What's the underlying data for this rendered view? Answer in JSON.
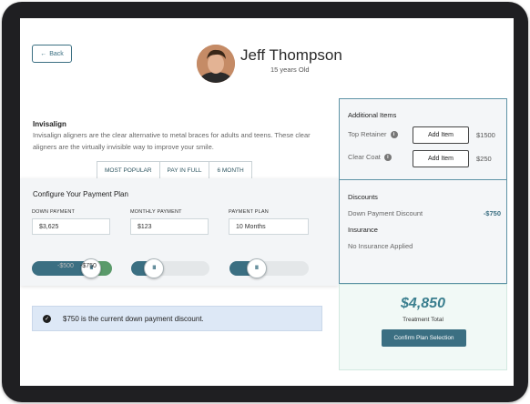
{
  "header": {
    "back_label": "Back",
    "back_icon": "arrow-left-icon",
    "patient_name": "Jeff Thompson",
    "patient_age": "15 years Old"
  },
  "product": {
    "title": "Invisalign",
    "description": "Invisalign aligners are the clear alternative to metal braces for adults and teens. These clear aligners are the virtually invisible way to improve your smile."
  },
  "tabs": [
    {
      "label": "MOST POPULAR"
    },
    {
      "label": "PAY IN FULL"
    },
    {
      "label": "6 MONTH"
    }
  ],
  "payment_plan": {
    "title": "Configure Your Payment Plan",
    "down_payment": {
      "label": "DOWN PAYMENT",
      "value": "$3,625",
      "slider_fraction": 0.73
    },
    "monthly_payment": {
      "label": "MONTHLY PAYMENT",
      "value": "$123",
      "slider_fraction": 0.28
    },
    "plan": {
      "label": "PAYMENT PLAN",
      "value": "10 Months",
      "slider_fraction": 0.33
    },
    "slider_handle_glyph": "III",
    "range_min": "-$500",
    "range_max": "-$750"
  },
  "info_message": "$750 is the current down payment discount.",
  "additional_items": {
    "title": "Additional Items",
    "items": [
      {
        "label": "Top Retainer",
        "button": "Add Item",
        "price": "$1500"
      },
      {
        "label": "Clear Coat",
        "button": "Add Item",
        "price": "$250"
      }
    ]
  },
  "discounts": {
    "title": "Discounts",
    "label": "Down Payment Discount",
    "value": "-$750"
  },
  "insurance": {
    "title": "Insurance",
    "label": "No Insurance Applied"
  },
  "total": {
    "amount": "$4,850",
    "label": "Treatment Total",
    "confirm_label": "Confirm Plan Selection"
  },
  "colors": {
    "accent": "#3b6f82",
    "slider_green": "#5a9a6a",
    "info_bg": "#dde8f6",
    "total_bg": "#f1f9f6"
  }
}
